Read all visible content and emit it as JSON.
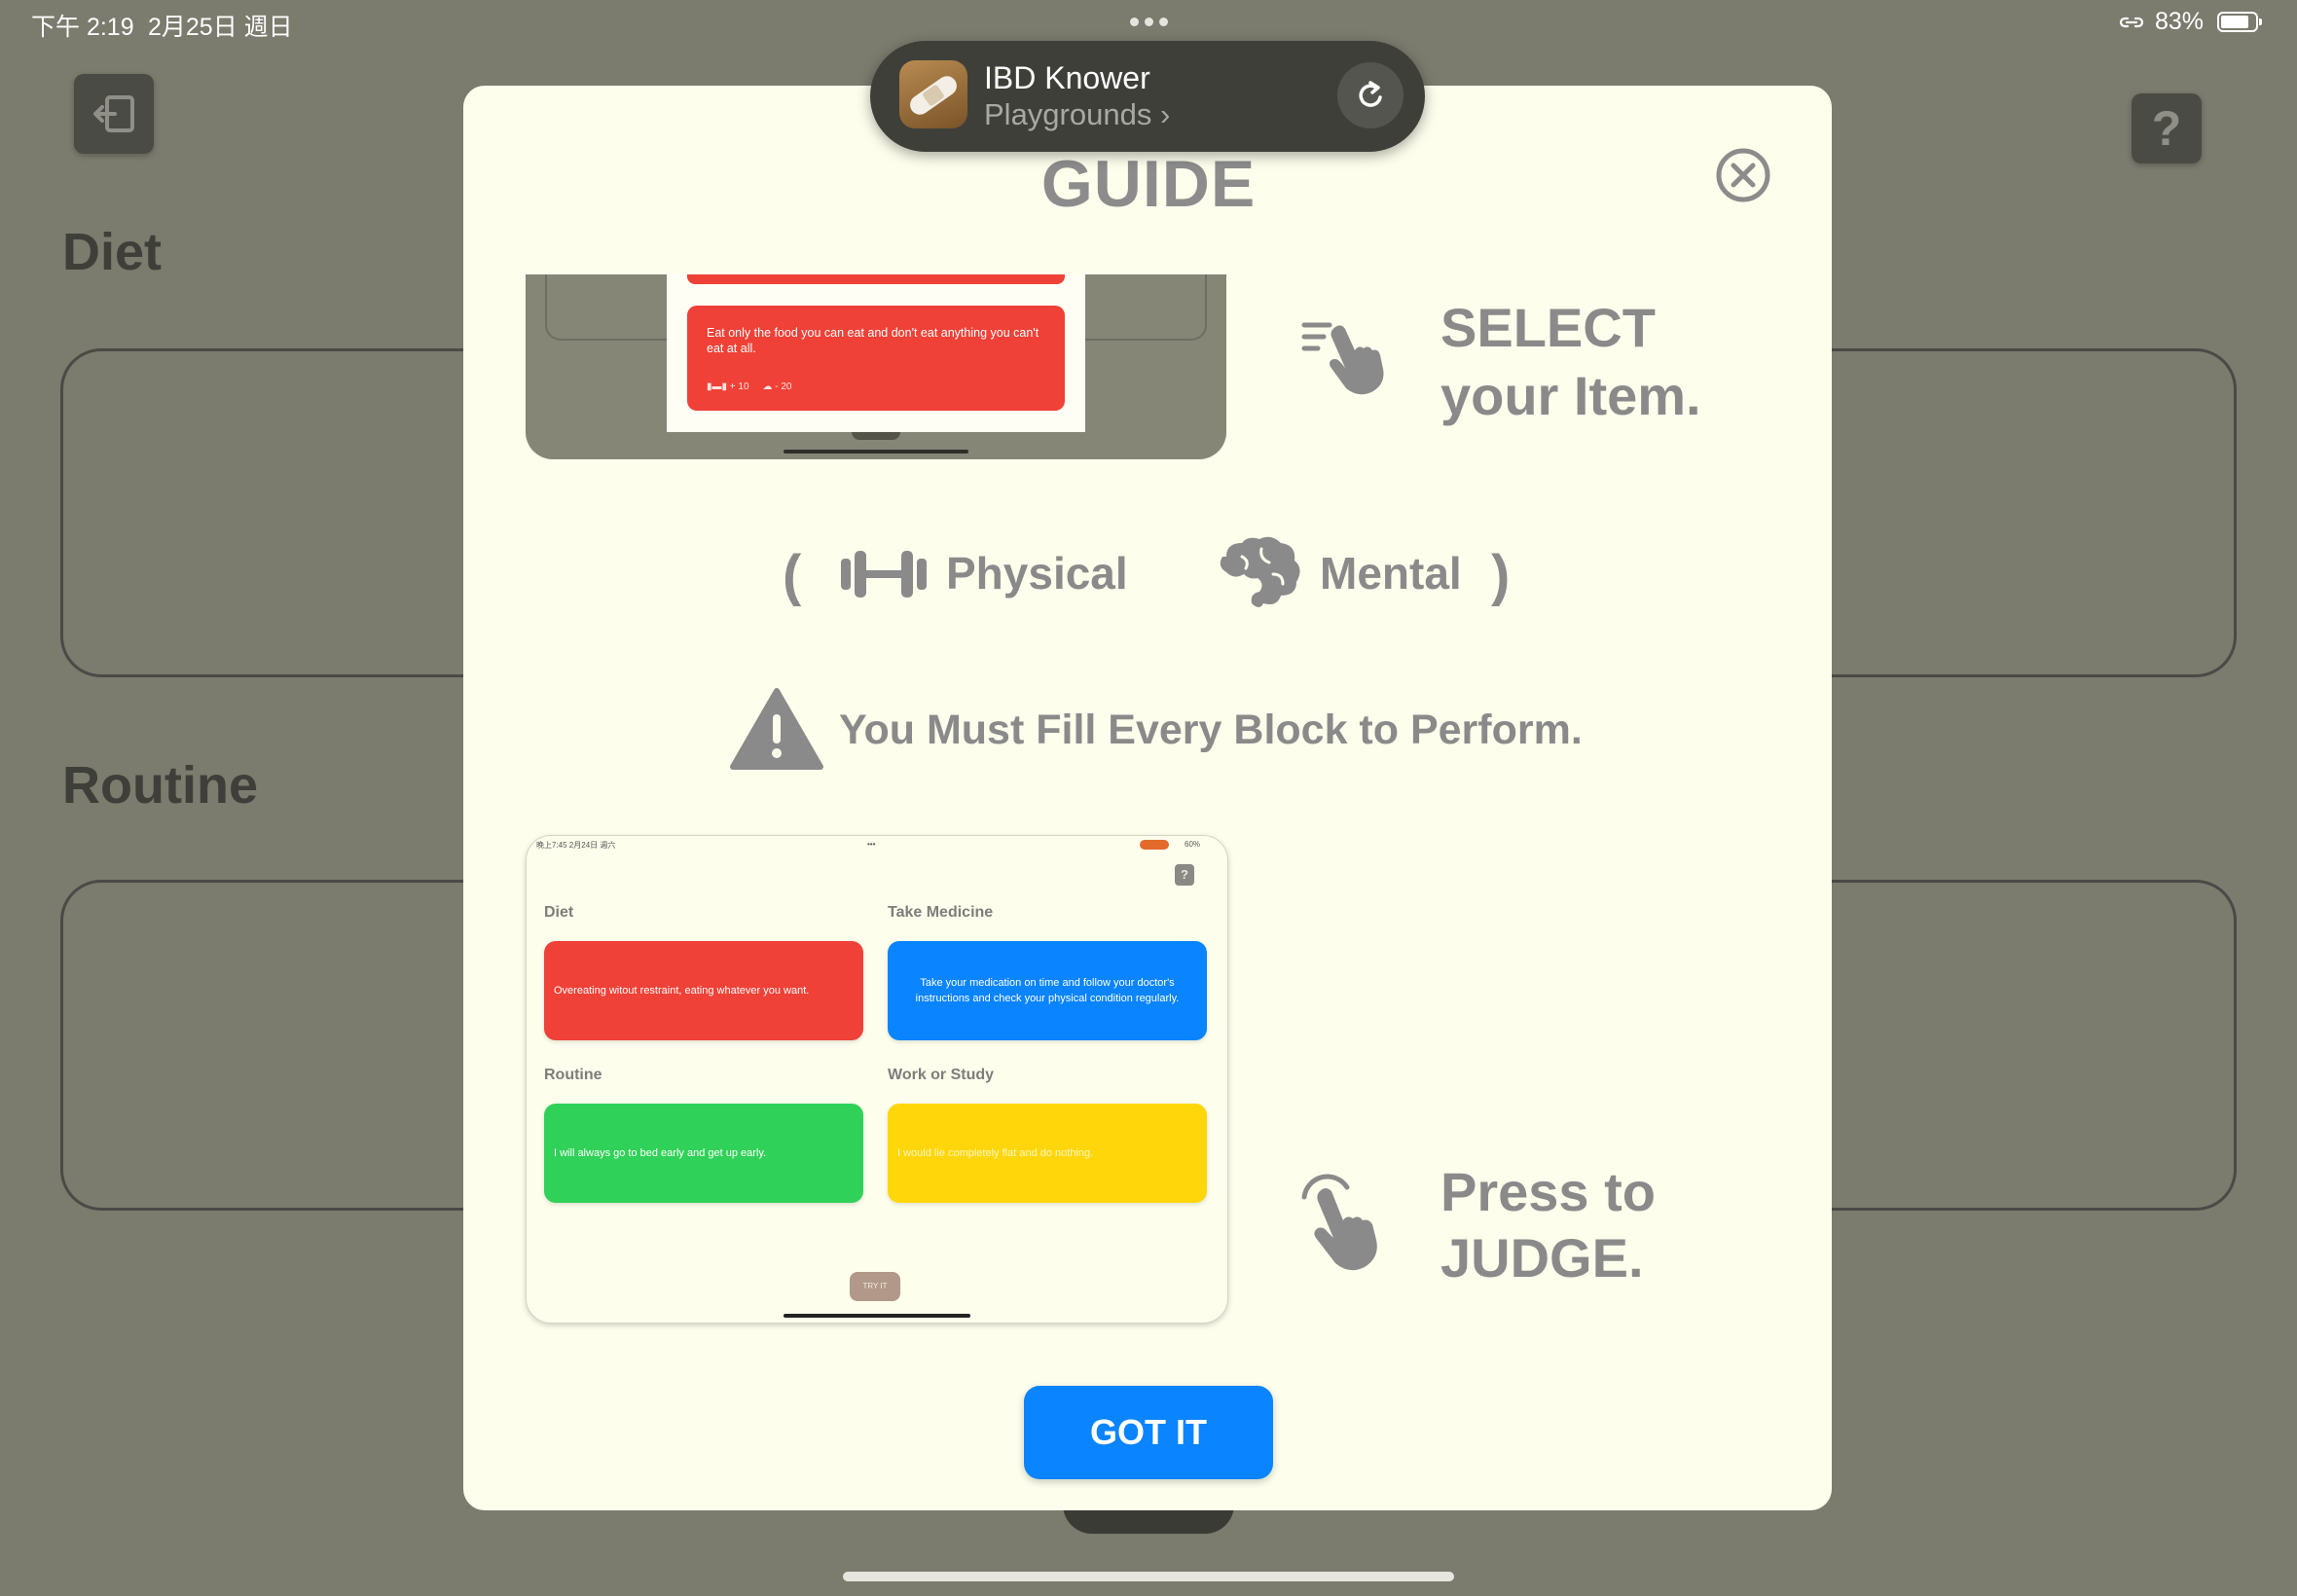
{
  "status_bar": {
    "time": "下午 2:19",
    "date": "2月25日 週日",
    "battery": "83%",
    "battery_level": 0.83
  },
  "background": {
    "diet_label": "Diet",
    "routine_label": "Routine",
    "help_glyph": "?",
    "exit_icon": "exit-icon"
  },
  "banner": {
    "app_name": "IBD Knower",
    "subtitle": "Playgrounds",
    "chevron": "›",
    "reload_icon": "reload-icon"
  },
  "modal": {
    "title": "GUIDE",
    "close_icon": "close-circle-icon",
    "step1": {
      "line1": "SELECT",
      "line2": "your Item.",
      "icon": "hand-swipe-icon"
    },
    "legend": {
      "open": "(",
      "close": ")",
      "physical": "Physical",
      "physical_icon": "dumbbell-icon",
      "mental": "Mental",
      "mental_icon": "brain-icon"
    },
    "warning": {
      "text": "You Must Fill Every Block to Perform.",
      "icon": "warning-icon"
    },
    "step2": {
      "line1": "Press to",
      "line2": "JUDGE.",
      "icon": "hand-tap-icon"
    },
    "got_it": "GOT IT"
  },
  "preview_select": {
    "card_text": "Eat only the food you can eat and don't eat anything you can't eat at all.",
    "physical_score": "+ 10",
    "mental_score": "- 20"
  },
  "preview_judge": {
    "status_left": "晚上7:45  2月24日 週六",
    "status_dots": "•••",
    "status_right": "60%",
    "help": "?",
    "diet_label": "Diet",
    "diet_text": "Overeating witout restraint, eating whatever you want.",
    "medicine_label": "Take Medicine",
    "medicine_text": "Take your medication on time and follow your doctor's instructions and check your physical condition regularly.",
    "routine_label": "Routine",
    "routine_text": "I will always go to bed early and get up early.",
    "work_label": "Work or Study",
    "work_text": "I would lie completely flat and do nothing.",
    "try_it": "TRY IT"
  },
  "colors": {
    "red": "#EF4137",
    "blue": "#0A84FF",
    "green": "#30D158",
    "yellow": "#FFD60A",
    "modal_bg": "#FEFEED",
    "gray_text": "#8A8A8A"
  }
}
